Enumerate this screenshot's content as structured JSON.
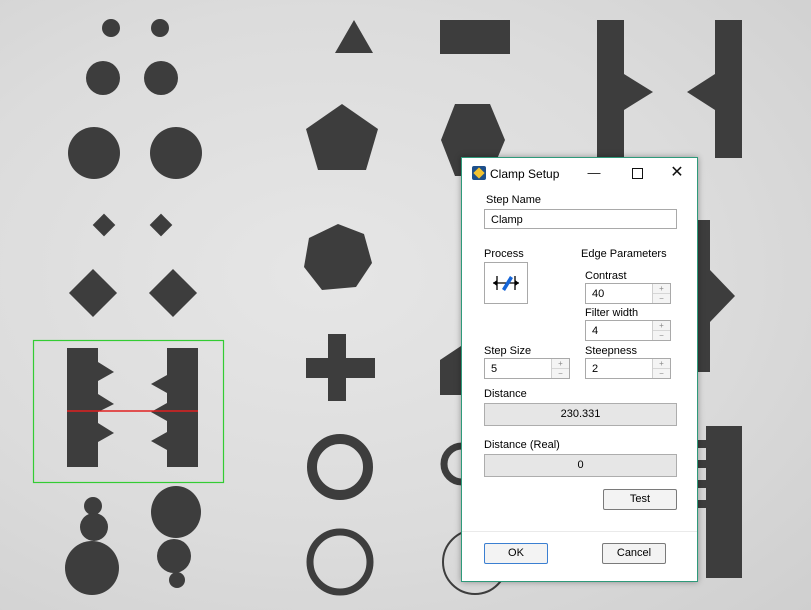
{
  "dialog": {
    "title": "Clamp Setup",
    "app_icon": "clamp-setup-app-icon",
    "controls": {
      "minimize": "—",
      "maximize": "",
      "close": "✕"
    },
    "step_name": {
      "label": "Step Name",
      "value": "Clamp"
    },
    "process": {
      "label": "Process",
      "icon": "clamp-tool-icon"
    },
    "edge_parameters": {
      "label": "Edge Parameters",
      "contrast": {
        "label": "Contrast",
        "value": "40"
      },
      "filter_width": {
        "label": "Filter width",
        "value": "4"
      },
      "steepness": {
        "label": "Steepness",
        "value": "2"
      }
    },
    "step_size": {
      "label": "Step Size",
      "value": "5"
    },
    "distance": {
      "label": "Distance",
      "value": "230.331"
    },
    "distance_real": {
      "label": "Distance (Real)",
      "value": "0"
    },
    "buttons": {
      "test": "Test",
      "ok": "OK",
      "cancel": "Cancel"
    },
    "spin_glyphs": {
      "up": "+",
      "down": "−"
    }
  },
  "overlay": {
    "roi_color": "#33cc33",
    "measure_line_color": "#e02020"
  }
}
